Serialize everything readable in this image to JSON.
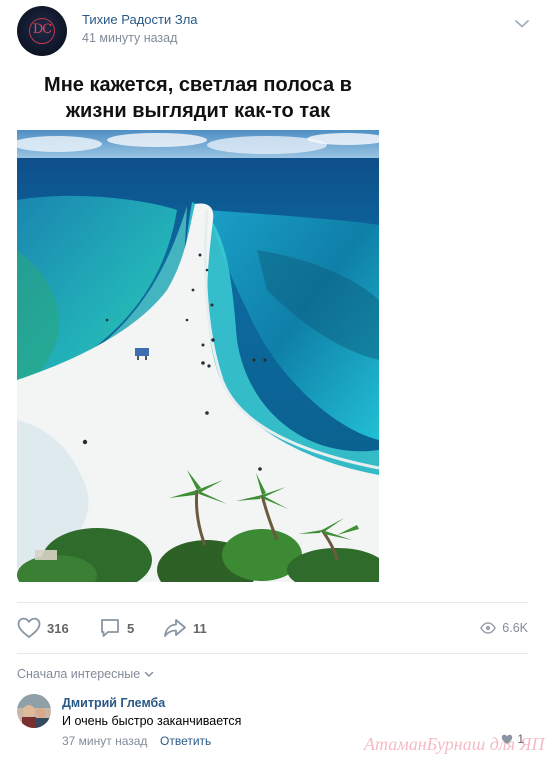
{
  "post": {
    "group_name": "Тихие Радости Зла",
    "avatar_monogram": "DC",
    "time": "41 минуту назад",
    "caption_line1": "Мне кажется, светлая полоса в",
    "caption_line2": "жизни выглядит как-то так",
    "photo_icon": "beach-sandbar-photo"
  },
  "actions": {
    "likes": "316",
    "comments": "5",
    "shares": "11",
    "views": "6.6K"
  },
  "comments_section": {
    "sort_label": "Сначала интересные",
    "items": [
      {
        "author": "Дмитрий Глемба",
        "text": "И очень быстро заканчивается",
        "time": "37 минут назад",
        "reply_label": "Ответить",
        "likes": "1"
      }
    ]
  },
  "watermark": "АтаманБурнаш для ЯП",
  "colors": {
    "link": "#2a5885",
    "muted": "#818c99",
    "divider": "#e7e8ec",
    "sea": "#1aa3c4",
    "sand": "#f4f6f6"
  }
}
